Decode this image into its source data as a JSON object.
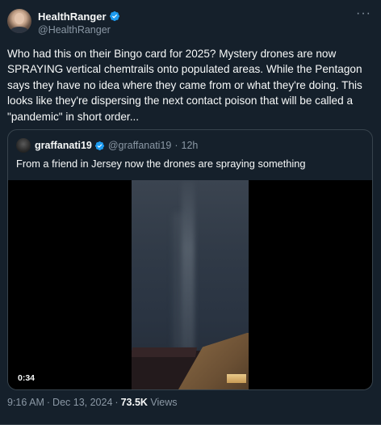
{
  "author": {
    "display_name": "HealthRanger",
    "handle": "@HealthRanger",
    "verified_icon": "verified-badge-icon"
  },
  "more_icon": "more-options-icon",
  "more_glyph": "···",
  "tweet": {
    "text": "Who had this on their Bingo card for 2025? Mystery drones are now SPRAYING vertical chemtrails onto populated areas. While the Pentagon says they have no idea where they came from or what they're doing. This looks like they're dispersing the next contact poison that will be called a \"pandemic\" in short order..."
  },
  "quoted": {
    "display_name": "graffanati19",
    "handle": "@graffanati19",
    "separator": "·",
    "time": "12h",
    "text": "From a friend in Jersey now the drones are spraying something",
    "video": {
      "duration": "0:34"
    }
  },
  "meta": {
    "time": "9:16 AM",
    "separator": "·",
    "date": "Dec 13, 2024",
    "separator2": "·",
    "views_count": "73.5K",
    "views_label": "Views"
  },
  "colors": {
    "background": "#15202b",
    "text": "#f7f9f9",
    "muted": "#8b98a5",
    "border": "#38444d",
    "verified": "#1d9bf0"
  }
}
